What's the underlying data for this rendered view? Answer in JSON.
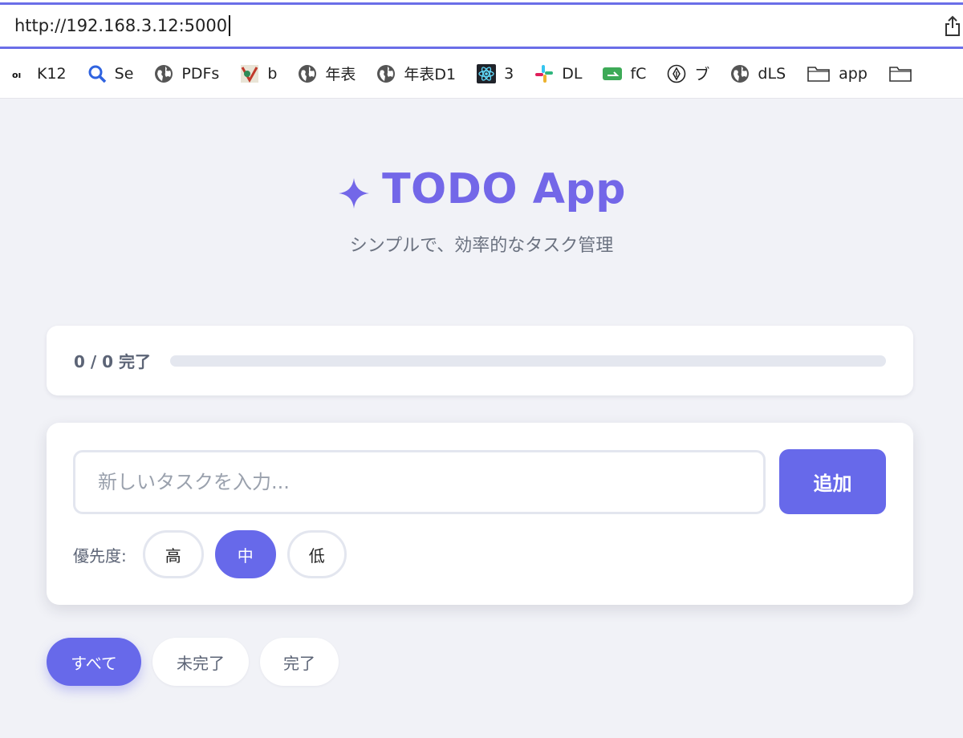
{
  "browser": {
    "url": "http://192.168.3.12:5000",
    "bookmarks": [
      {
        "label": "K12",
        "icon": "oi-badge-icon"
      },
      {
        "label": "Se",
        "icon": "magnifier-icon"
      },
      {
        "label": "PDFs",
        "icon": "globe-icon"
      },
      {
        "label": "b",
        "icon": "colorful-logo-icon"
      },
      {
        "label": "年表",
        "icon": "globe-icon"
      },
      {
        "label": "年表D1",
        "icon": "globe-icon"
      },
      {
        "label": "3",
        "icon": "react-atom-icon"
      },
      {
        "label": "DL",
        "icon": "slack-icon"
      },
      {
        "label": "fC",
        "icon": "green-card-icon"
      },
      {
        "label": "ブ",
        "icon": "pen-nib-icon"
      },
      {
        "label": "dLS",
        "icon": "globe-icon"
      },
      {
        "label": "app",
        "icon": "folder-icon"
      },
      {
        "label": "",
        "icon": "folder-icon"
      }
    ]
  },
  "app": {
    "title": "TODO App",
    "subtitle": "シンプルで、効率的なタスク管理",
    "accent_color": "#6769ea",
    "title_color": "#7367e8"
  },
  "progress": {
    "text": "0 / 0 完了",
    "completed": 0,
    "total": 0,
    "fraction": 0
  },
  "form": {
    "input_value": "",
    "placeholder": "新しいタスクを入力...",
    "add_label": "追加",
    "priority_label": "優先度:",
    "priorities": [
      {
        "label": "高",
        "selected": false
      },
      {
        "label": "中",
        "selected": true
      },
      {
        "label": "低",
        "selected": false
      }
    ]
  },
  "filters": [
    {
      "label": "すべて",
      "active": true
    },
    {
      "label": "未完了",
      "active": false
    },
    {
      "label": "完了",
      "active": false
    }
  ]
}
